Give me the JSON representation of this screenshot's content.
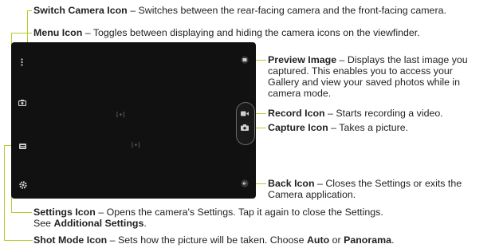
{
  "callouts": {
    "switch_camera": {
      "name": "Switch Camera Icon",
      "desc": " – Switches between the rear-facing camera and the front-facing camera."
    },
    "menu": {
      "name": "Menu Icon",
      "desc": " – Toggles between displaying and hiding the camera icons on the viewfinder."
    },
    "preview": {
      "name": "Preview Image",
      "desc1": " – Displays the last image you",
      "desc2": "captured. This enables you to access your",
      "desc3": "Gallery and view your saved photos while in",
      "desc4": "camera mode."
    },
    "record": {
      "name": "Record Icon",
      "desc": " – Starts recording a video."
    },
    "capture": {
      "name": "Capture Icon",
      "desc": " – Takes a picture."
    },
    "back": {
      "name": "Back Icon",
      "desc1": " – Closes the Settings or exits the",
      "desc2": "Camera application."
    },
    "settings": {
      "name": "Settings Icon",
      "desc1": " – Opens the camera's Settings. Tap it again to close the Settings.",
      "desc2_prefix": "See ",
      "desc2_link": "Additional Settings",
      "desc2_suffix": "."
    },
    "shot_mode": {
      "name": "Shot Mode Icon",
      "desc_prefix": " – Sets how the picture will be taken. Choose ",
      "opt1": "Auto",
      "desc_mid": " or ",
      "opt2": "Panorama",
      "desc_suffix": "."
    }
  },
  "viewfinder": {
    "focus_mark_1": "[+]",
    "focus_mark_2": "[+]"
  },
  "colors": {
    "leader_line": "#b7cc2e",
    "viewfinder_bg": "#111111",
    "icon": "#cfcfcf"
  },
  "icons": [
    "menu-icon",
    "switch-camera-icon",
    "shot-mode-icon",
    "settings-icon",
    "preview-image-icon",
    "record-icon",
    "capture-icon",
    "back-icon"
  ]
}
